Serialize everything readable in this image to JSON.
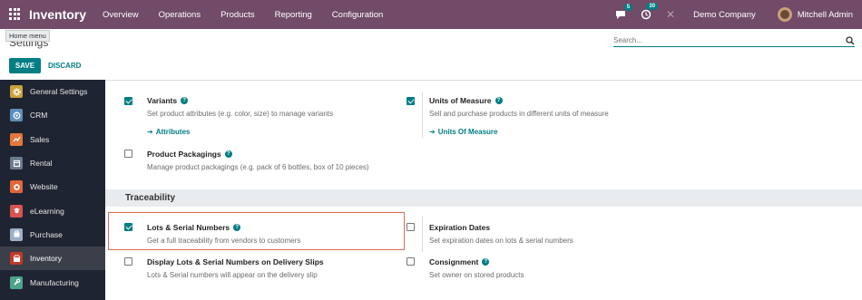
{
  "navbar": {
    "app_title": "Inventory",
    "menu": [
      "Overview",
      "Operations",
      "Products",
      "Reporting",
      "Configuration"
    ],
    "messages_badge": "5",
    "activities_badge": "30",
    "company": "Demo Company",
    "user": "Mitchell Admin"
  },
  "tooltip": "Home menu",
  "control_panel": {
    "title": "Settings",
    "search_placeholder": "Search...",
    "save_label": "SAVE",
    "discard_label": "DISCARD"
  },
  "sidebar": {
    "items": [
      {
        "label": "General Settings",
        "icon": "gear-icon",
        "color": "#c9a13b"
      },
      {
        "label": "CRM",
        "icon": "crm-icon",
        "color": "#5b8fb9"
      },
      {
        "label": "Sales",
        "icon": "sales-chart-icon",
        "color": "#e5763c"
      },
      {
        "label": "Rental",
        "icon": "rental-icon",
        "color": "#6a7a8c"
      },
      {
        "label": "Website",
        "icon": "globe-icon",
        "color": "#e2663b"
      },
      {
        "label": "eLearning",
        "icon": "elearning-icon",
        "color": "#d9534f"
      },
      {
        "label": "Purchase",
        "icon": "purchase-icon",
        "color": "#9bb0c4"
      },
      {
        "label": "Inventory",
        "icon": "inventory-box-icon",
        "color": "#c0392b"
      },
      {
        "label": "Manufacturing",
        "icon": "wrench-icon",
        "color": "#4aa38a"
      }
    ],
    "active_index": 7
  },
  "settings": {
    "variants": {
      "title": "Variants",
      "desc": "Set product attributes (e.g. color, size) to manage variants",
      "link": "Attributes",
      "checked": true
    },
    "uom": {
      "title": "Units of Measure",
      "desc": "Sell and purchase products in different units of measure",
      "link": "Units Of Measure",
      "checked": true
    },
    "packagings": {
      "title": "Product Packagings",
      "desc": "Manage product packagings (e.g. pack of 6 bottles, box of 10 pieces)",
      "checked": false
    },
    "section_traceability": "Traceability",
    "lots": {
      "title": "Lots & Serial Numbers",
      "desc": "Get a full traceability from vendors to customers",
      "checked": true
    },
    "expiration": {
      "title": "Expiration Dates",
      "desc": "Set expiration dates on lots & serial numbers",
      "checked": false
    },
    "display_lots": {
      "title": "Display Lots & Serial Numbers on Delivery Slips",
      "desc": "Lots & Serial numbers will appear on the delivery slip",
      "checked": false
    },
    "consignment": {
      "title": "Consignment",
      "desc": "Set owner on stored products",
      "checked": false
    }
  }
}
